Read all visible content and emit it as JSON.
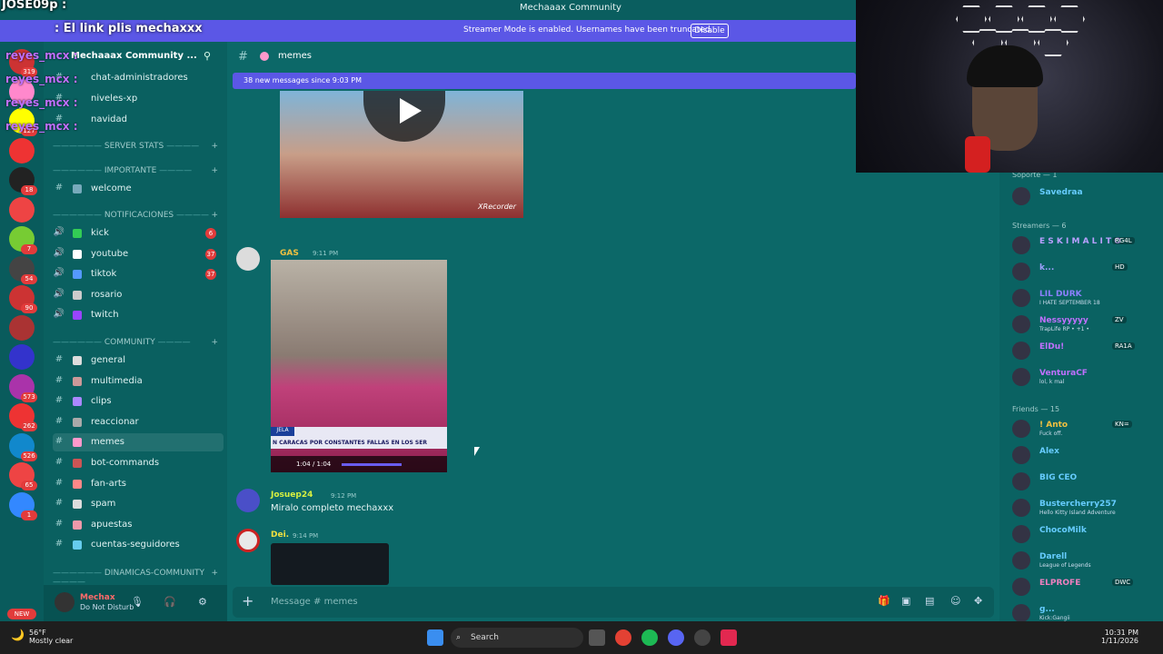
{
  "window": {
    "title": "Mechaaax Community"
  },
  "overlay": {
    "top_user": "JOSE09p :",
    "chat_msg": ": El link plis mechaxxx",
    "chat_user": "reyes_mcx :"
  },
  "streamer_mode": {
    "message": "Streamer Mode is enabled. Usernames have been truncated.",
    "button": "Disable"
  },
  "server": {
    "name": "Mechaaax Community ..."
  },
  "server_rail": {
    "badges": [
      "319",
      "",
      "127",
      "",
      "18",
      "",
      "7",
      "54",
      "90",
      "",
      "",
      "573",
      "262",
      "526",
      "65",
      "1"
    ],
    "new_label": "NEW"
  },
  "sidebar": {
    "top_channels": [
      "chat-administradores",
      "niveles-xp",
      "navidad"
    ],
    "categories": [
      "SERVER STATS",
      "IMPORTANTE",
      "NOTIFICACIONES",
      "COMMUNITY",
      "DINAMICAS-COMMUNITY"
    ],
    "importante": [
      {
        "label": "welcome",
        "color": "#7ab"
      }
    ],
    "notificaciones": [
      {
        "label": "kick",
        "count": "6",
        "color": "#3c5"
      },
      {
        "label": "youtube",
        "count": "37",
        "color": "#fff"
      },
      {
        "label": "tiktok",
        "count": "37",
        "color": "#59f"
      },
      {
        "label": "rosario",
        "count": "",
        "color": "#ccc"
      },
      {
        "label": "twitch",
        "count": "",
        "color": "#94f"
      }
    ],
    "community": [
      {
        "label": "general",
        "color": "#ddd"
      },
      {
        "label": "multimedia",
        "color": "#c99"
      },
      {
        "label": "clips",
        "color": "#a8f"
      },
      {
        "label": "reaccionar",
        "color": "#aaa"
      },
      {
        "label": "memes",
        "color": "#f9c",
        "active": true
      },
      {
        "label": "bot-commands",
        "color": "#c55"
      },
      {
        "label": "fan-arts",
        "color": "#f88"
      },
      {
        "label": "spam",
        "color": "#ddd"
      },
      {
        "label": "apuestas",
        "color": "#e9a"
      },
      {
        "label": "cuentas-seguidores",
        "color": "#6ce"
      }
    ]
  },
  "user": {
    "name": "Mechax",
    "status": "Do Not Disturb"
  },
  "channel": {
    "name": "memes",
    "new_messages": "38 new messages since 9:03 PM"
  },
  "messages": [
    {
      "author": "GAS",
      "time": "9:11 PM",
      "color": "#f0c040",
      "video_label": "JELA",
      "video_caption": "N CARACAS POR CONSTANTES FALLAS EN LOS SER",
      "video_time": "1:04 / 1:04",
      "watermark": "XRecorder"
    },
    {
      "author": "Josuep24",
      "time": "9:12 PM",
      "color": "#d8f040",
      "text": "Miralo completo mechaxxx"
    },
    {
      "author": "Dei.",
      "time": "9:14 PM",
      "color": "#f0e040"
    }
  ],
  "input": {
    "placeholder": "Message #",
    "channel": "memes"
  },
  "members": {
    "sections": [
      "Soporte — 1",
      "Streamers — 6",
      "Friends — 15"
    ],
    "soporte": [
      {
        "name": "Savedraa",
        "status": "",
        "color": "#6cf"
      }
    ],
    "streamers": [
      {
        "name": "E S K I M A L I T O",
        "status": "",
        "color": "#b8a0ff",
        "tag": "RG4L"
      },
      {
        "name": "k...",
        "status": "",
        "color": "#a0a0ff",
        "tag": "HD"
      },
      {
        "name": "LIL DURK",
        "status": "I HATE SEPTEMBER 18",
        "color": "#8c80ff"
      },
      {
        "name": "Nessyyyyy",
        "status": "TrapLife RP • +1 •",
        "color": "#c070ff",
        "tag": "ZV"
      },
      {
        "name": "ElDu!",
        "status": "",
        "color": "#c070ff",
        "tag": "RA1A"
      },
      {
        "name": "VenturaCF",
        "status": "lol, k mal",
        "color": "#c070ff"
      }
    ],
    "friends": [
      {
        "name": "! Anto",
        "status": "Fuck off.",
        "color": "#f0c040",
        "tag": "KN="
      },
      {
        "name": "Alex",
        "status": "",
        "color": "#6cf"
      },
      {
        "name": "BIG CEO",
        "status": "",
        "color": "#6cf"
      },
      {
        "name": "Bustercherry257",
        "status": "Hello Kitty Island Adventure",
        "color": "#6cf"
      },
      {
        "name": "ChocoMilk",
        "status": "",
        "color": "#6cf"
      },
      {
        "name": "Darell",
        "status": "League of Legends",
        "color": "#6cf"
      },
      {
        "name": "ELPROFE",
        "status": "",
        "color": "#f080c0",
        "tag": "DWC"
      },
      {
        "name": "g...",
        "status": "Kick:Gangii",
        "color": "#6cf"
      }
    ]
  },
  "taskbar": {
    "weather_temp": "56°F",
    "weather_desc": "Mostly clear",
    "search": "Search",
    "time": "10:31 PM",
    "date": "1/11/2026"
  }
}
